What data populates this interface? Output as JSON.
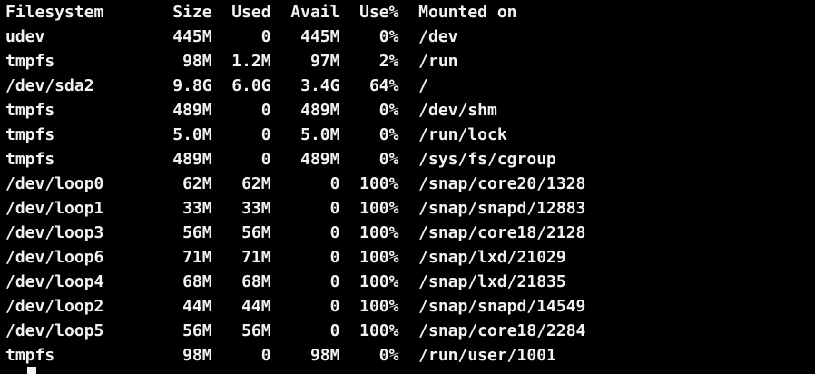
{
  "terminal": {
    "colors": {
      "background": "#000000",
      "foreground": "#f2f2f2"
    },
    "header": "Filesystem       Size  Used  Avail  Use%  Mounted on",
    "lines": [
      "udev             445M     0   445M    0%  /dev",
      "tmpfs             98M  1.2M    97M    2%  /run",
      "/dev/sda2        9.8G  6.0G   3.4G   64%  /",
      "tmpfs            489M     0   489M    0%  /dev/shm",
      "tmpfs            5.0M     0   5.0M    0%  /run/lock",
      "tmpfs            489M     0   489M    0%  /sys/fs/cgroup",
      "/dev/loop0        62M   62M      0  100%  /snap/core20/1328",
      "/dev/loop1        33M   33M      0  100%  /snap/snapd/12883",
      "/dev/loop3        56M   56M      0  100%  /snap/core18/2128",
      "/dev/loop6        71M   71M      0  100%  /snap/lxd/21029",
      "/dev/loop4        68M   68M      0  100%  /snap/lxd/21835",
      "/dev/loop2        44M   44M      0  100%  /snap/snapd/14549",
      "/dev/loop5        56M   56M      0  100%  /snap/core18/2284",
      "tmpfs             98M     0    98M    0%  /run/user/1001"
    ]
  }
}
